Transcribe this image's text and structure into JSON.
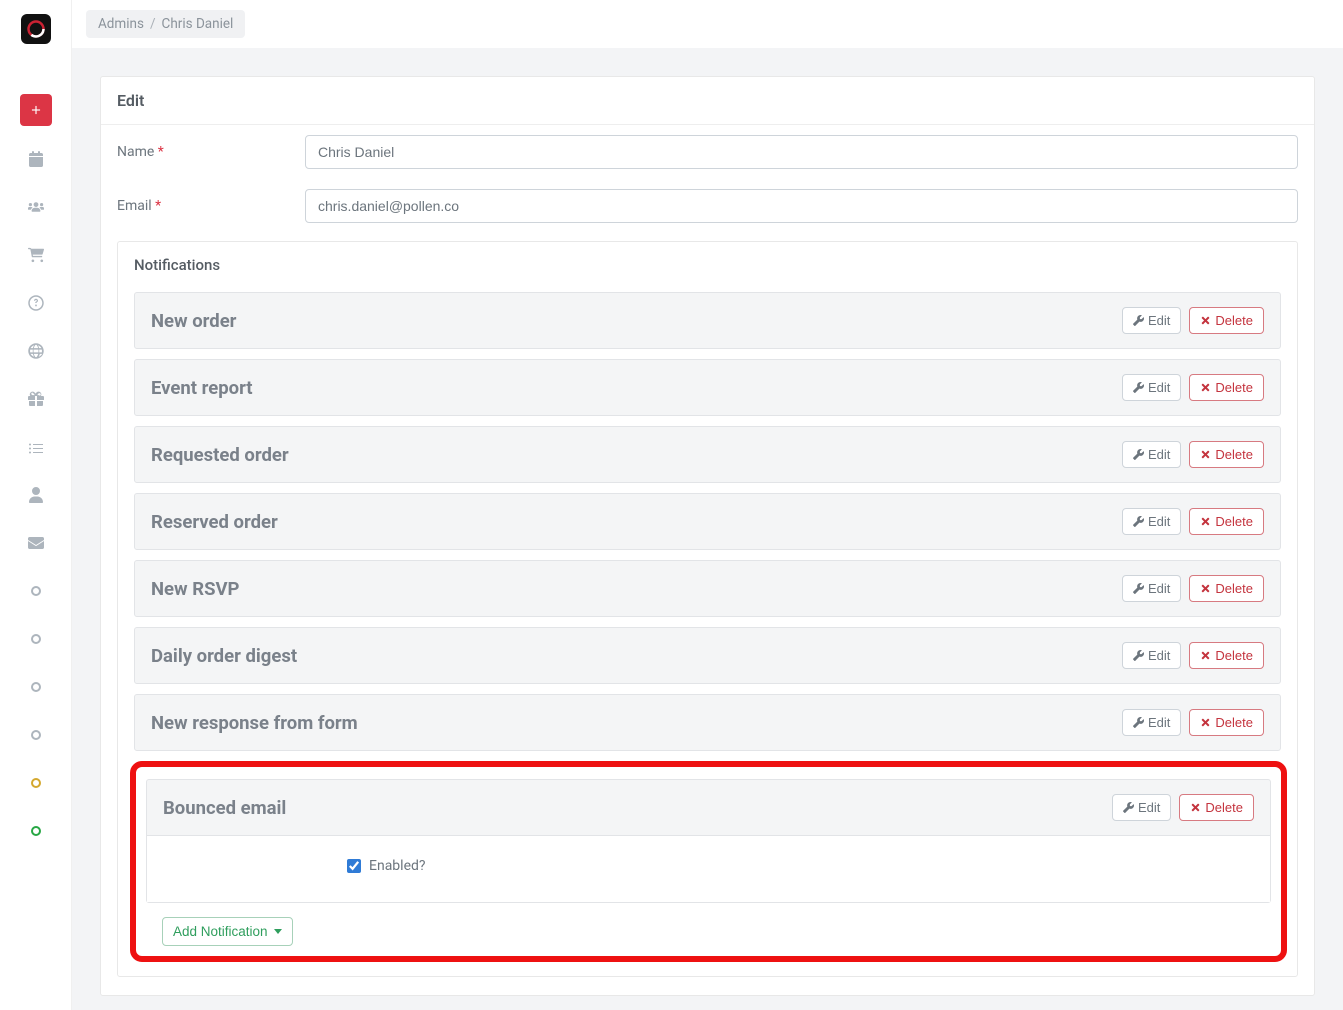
{
  "breadcrumb": {
    "parent": "Admins",
    "current": "Chris Daniel"
  },
  "edit": {
    "heading": "Edit",
    "name_label": "Name",
    "name_value": "Chris Daniel",
    "email_label": "Email",
    "email_value": "chris.daniel@pollen.co"
  },
  "notifications": {
    "heading": "Notifications",
    "edit_label": "Edit",
    "delete_label": "Delete",
    "items": [
      {
        "title": "New order"
      },
      {
        "title": "Event report"
      },
      {
        "title": "Requested order"
      },
      {
        "title": "Reserved order"
      },
      {
        "title": "New RSVP"
      },
      {
        "title": "Daily order digest"
      },
      {
        "title": "New response from form"
      }
    ],
    "expanded": {
      "title": "Bounced email",
      "enabled_label": "Enabled?",
      "enabled_checked": true
    },
    "add_label": "Add Notification"
  },
  "sidebar": {
    "icons": [
      "calendar-icon",
      "users-icon",
      "cart-icon",
      "help-icon",
      "globe-icon",
      "gift-icon",
      "list-icon",
      "user-icon",
      "mail-icon"
    ]
  }
}
